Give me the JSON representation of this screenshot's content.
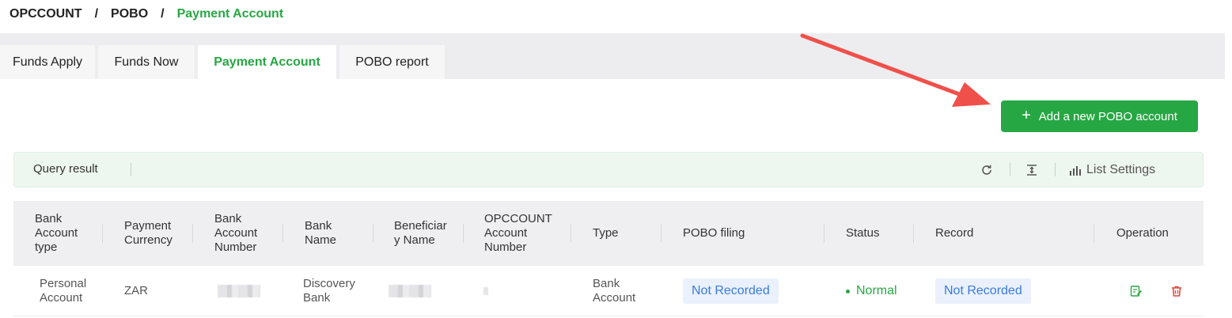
{
  "breadcrumb": {
    "items": [
      "OPCCOUNT",
      "POBO"
    ],
    "separator": "/",
    "current": "Payment Account"
  },
  "tabs": [
    {
      "label": "Funds Apply",
      "active": false
    },
    {
      "label": "Funds Now",
      "active": false
    },
    {
      "label": "Payment Account",
      "active": true
    },
    {
      "label": "POBO report",
      "active": false
    }
  ],
  "add_button": {
    "label": "Add a new POBO account",
    "icon": "plus-icon"
  },
  "query_bar": {
    "label": "Query result",
    "tools": {
      "refresh_icon": "refresh-icon",
      "density_icon": "density-icon",
      "settings_icon": "bar-chart-icon",
      "settings_label": "List Settings"
    }
  },
  "table": {
    "columns": [
      [
        "Bank",
        "Account",
        "type"
      ],
      [
        "Payment",
        "Currency"
      ],
      [
        "Bank",
        "Account",
        "Number"
      ],
      [
        "Bank",
        "Name"
      ],
      [
        "Beneficiar",
        "y Name"
      ],
      [
        "OPCCOUNT",
        "Account",
        "Number"
      ],
      [
        "Type"
      ],
      [
        "POBO filing"
      ],
      [
        "Status"
      ],
      [
        "Record"
      ],
      [
        "Operation"
      ]
    ],
    "rows": [
      {
        "account_type": [
          "Personal",
          "Account"
        ],
        "currency": "ZAR",
        "account_number": "",
        "bank_name": [
          "Discovery",
          "Bank"
        ],
        "beneficiary_name": "",
        "opccount_account_number": "",
        "type": [
          "Bank",
          "Account"
        ],
        "pobo_filing": "Not Recorded",
        "status": "Normal",
        "record": "Not Recorded",
        "operations": {
          "edit_icon": "edit-icon",
          "delete_icon": "trash-icon"
        }
      }
    ]
  },
  "colors": {
    "accent": "#27a744",
    "tag_bg": "#eaf1fc",
    "tag_text": "#3b7be0",
    "delete": "#e0453a",
    "annotation_arrow": "#f0504a"
  }
}
